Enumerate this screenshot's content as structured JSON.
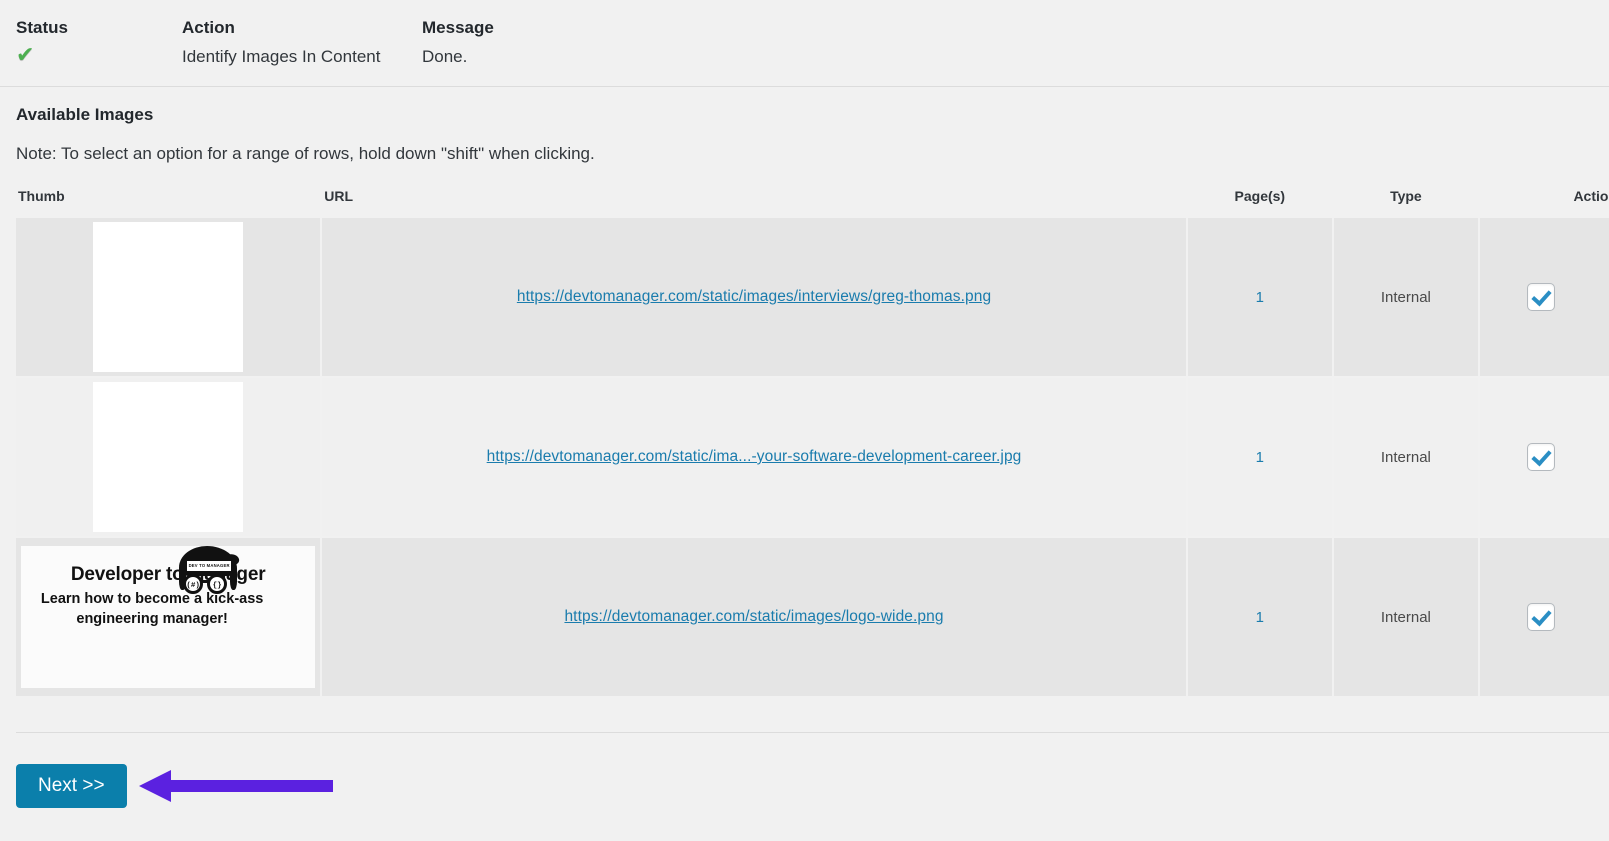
{
  "status_table": {
    "headers": {
      "status": "Status",
      "action": "Action",
      "message": "Message"
    },
    "row": {
      "status_icon": "green-check-icon",
      "status_glyph": "✔",
      "action": "Identify Images In Content",
      "message": "Done."
    }
  },
  "section": {
    "title": "Available Images",
    "note": "Note: To select an option for a range of rows, hold down \"shift\" when clicking."
  },
  "images_table": {
    "headers": {
      "thumb": "Thumb",
      "url": "URL",
      "pages": "Page(s)",
      "type": "Type",
      "action": "Action"
    },
    "rows": [
      {
        "thumb_alt": "portrait-photo-thumbnail",
        "url": "https://devtomanager.com/static/images/interviews/greg-thomas.png",
        "pages": "1",
        "type": "Internal",
        "checked": true
      },
      {
        "thumb_alt": "person-with-laptop-and-books-photo-thumbnail",
        "url": "https://devtomanager.com/static/ima...-your-software-development-career.jpg",
        "pages": "1",
        "type": "Internal",
        "checked": true
      },
      {
        "thumb_alt": "developer-to-manager-logo-thumbnail",
        "url": "https://devtomanager.com/static/images/logo-wide.png",
        "pages": "1",
        "type": "Internal",
        "checked": true
      }
    ]
  },
  "logo_thumb": {
    "badge_text": "DEV TO MANAGER",
    "lens_left": "(#)",
    "lens_right": "{}",
    "title": "Developer to Manager",
    "subtitle": "Learn how to become a kick-ass engineering manager!"
  },
  "footer": {
    "next_label": "Next >>",
    "annotation_arrow": "left-pointing-arrow-annotation"
  },
  "colors": {
    "accent_blue": "#0b7fab",
    "link_blue": "#1a7cad",
    "annotation_purple": "#5b21e0",
    "check_green": "#4caf50",
    "row_odd_bg": "#e5e5e5",
    "row_even_bg": "#f0f0f0",
    "page_bg": "#f1f1f1"
  }
}
